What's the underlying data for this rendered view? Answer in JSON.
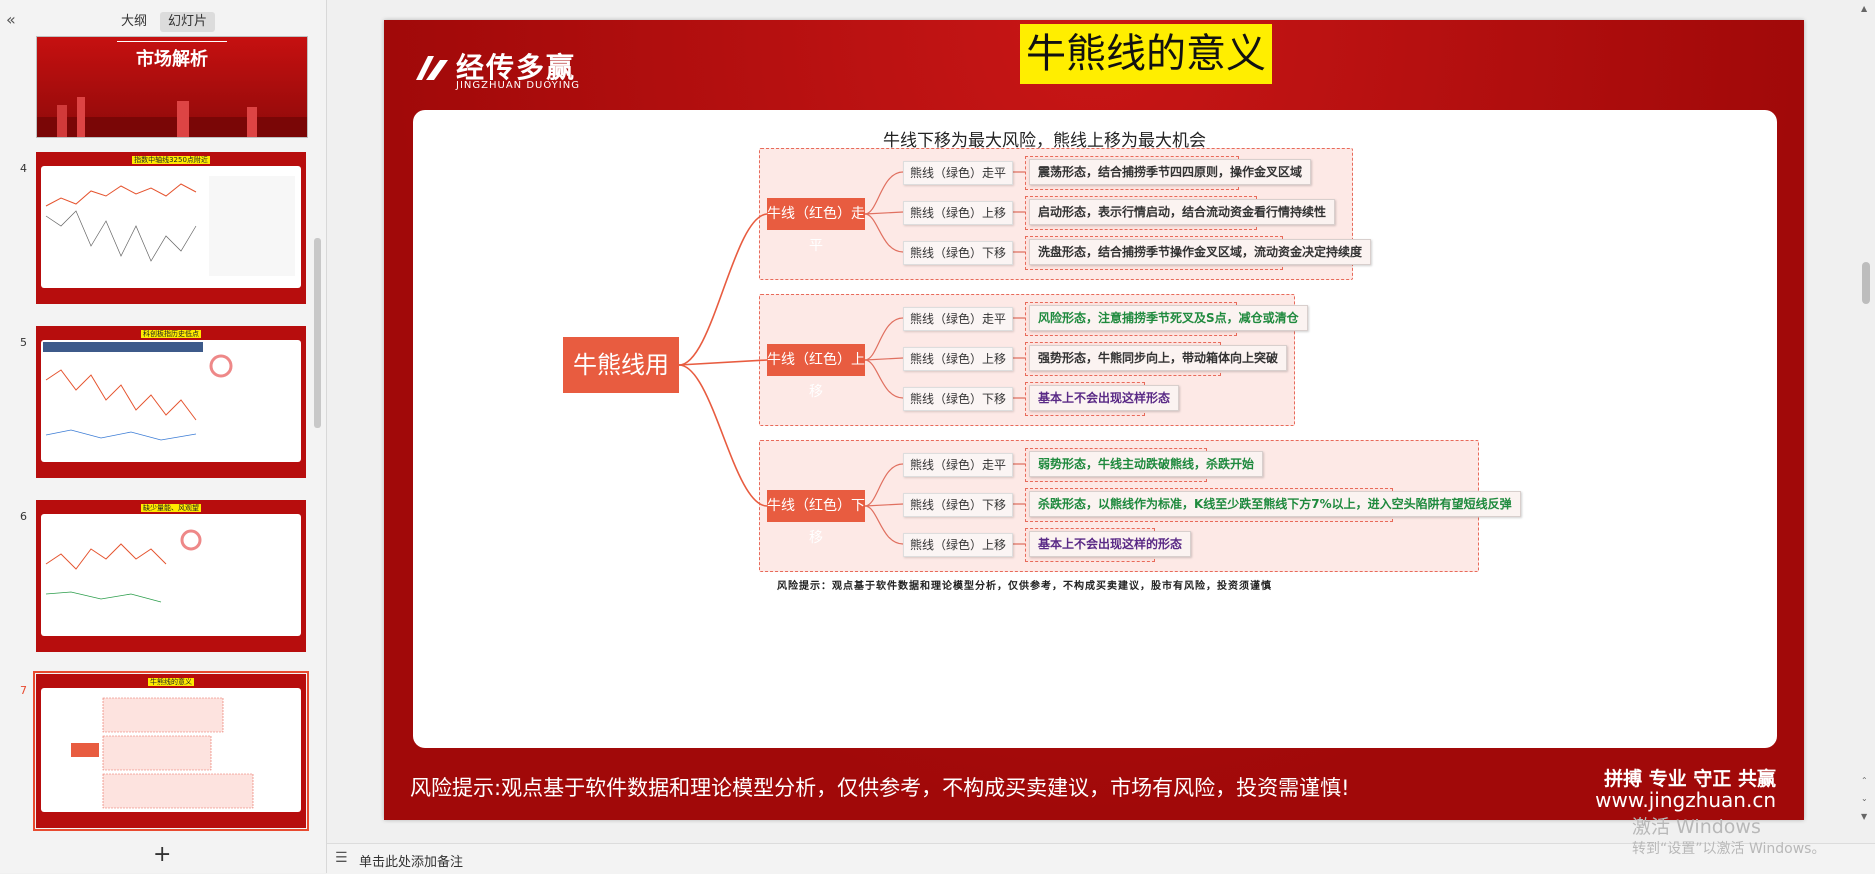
{
  "left_panel": {
    "tabs": [
      "大纲",
      "幻灯片"
    ],
    "active_tab": "幻灯片",
    "slides": [
      {
        "num": "",
        "title": "市场解析"
      },
      {
        "num": "4",
        "title": "指数中轴线3250点附近"
      },
      {
        "num": "5",
        "title": "科创板指历史低点"
      },
      {
        "num": "6",
        "title": "缺少量能、风观望"
      },
      {
        "num": "7",
        "title": "牛熊线的意义"
      }
    ],
    "selected_slide": "7"
  },
  "slide": {
    "logo_cn": "经传多赢",
    "logo_en": "JINGZHUAN DUOYING",
    "title": "牛熊线的意义",
    "mindmap": {
      "header": "牛线下移为最大风险，熊线上移为最大机会",
      "root": "牛熊线用法",
      "groups": [
        {
          "label": "牛线（红色）走平",
          "items": [
            {
              "cond": "熊线（绿色）走平",
              "desc": "震荡形态，结合捕捞季节四四原则，操作金叉区域",
              "color": "dark"
            },
            {
              "cond": "熊线（绿色）上移",
              "desc": "启动形态，表示行情启动，结合流动资金看行情持续性",
              "color": "dark"
            },
            {
              "cond": "熊线（绿色）下移",
              "desc": "洗盘形态，结合捕捞季节操作金叉区域，流动资金决定持续度",
              "color": "dark"
            }
          ]
        },
        {
          "label": "牛线（红色）上移",
          "items": [
            {
              "cond": "熊线（绿色）走平",
              "desc": "风险形态，注意捕捞季节死叉及S点，减仓或清仓",
              "color": "green"
            },
            {
              "cond": "熊线（绿色）上移",
              "desc": "强势形态，牛熊同步向上，带动箱体向上突破",
              "color": "dark"
            },
            {
              "cond": "熊线（绿色）下移",
              "desc": "基本上不会出现这样形态",
              "color": "purple"
            }
          ]
        },
        {
          "label": "牛线（红色）下移",
          "items": [
            {
              "cond": "熊线（绿色）走平",
              "desc": "弱势形态，牛线主动跌破熊线，杀跌开始",
              "color": "green"
            },
            {
              "cond": "熊线（绿色）下移",
              "desc": "杀跌形态，以熊线作为标准，K线至少跌至熊线下方7%以上，进入空头陷阱有望短线反弹",
              "color": "green"
            },
            {
              "cond": "熊线（绿色）上移",
              "desc": "基本上不会出现这样的形态",
              "color": "purple"
            }
          ]
        }
      ],
      "risk_note": "风险提示：观点基于软件数据和理论模型分析，仅供参考，不构成买卖建议，股市有风险，投资须谨慎"
    },
    "footer_risk": "风险提示:观点基于软件数据和理论模型分析，仅供参考，不构成买卖建议，市场有风险，投资需谨慎!",
    "footer_slogan": "拼搏 专业 守正 共赢",
    "footer_url": "www.jingzhuan.cn"
  },
  "bottom": {
    "notes_placeholder": "单击此处添加备注"
  },
  "watermark": {
    "line1": "激活 Windows",
    "line2": "转到“设置”以激活 Windows。"
  },
  "colors": {
    "slide_bg": "#b00c0c",
    "accent": "#e85c40",
    "title_highlight": "#ffee00"
  }
}
